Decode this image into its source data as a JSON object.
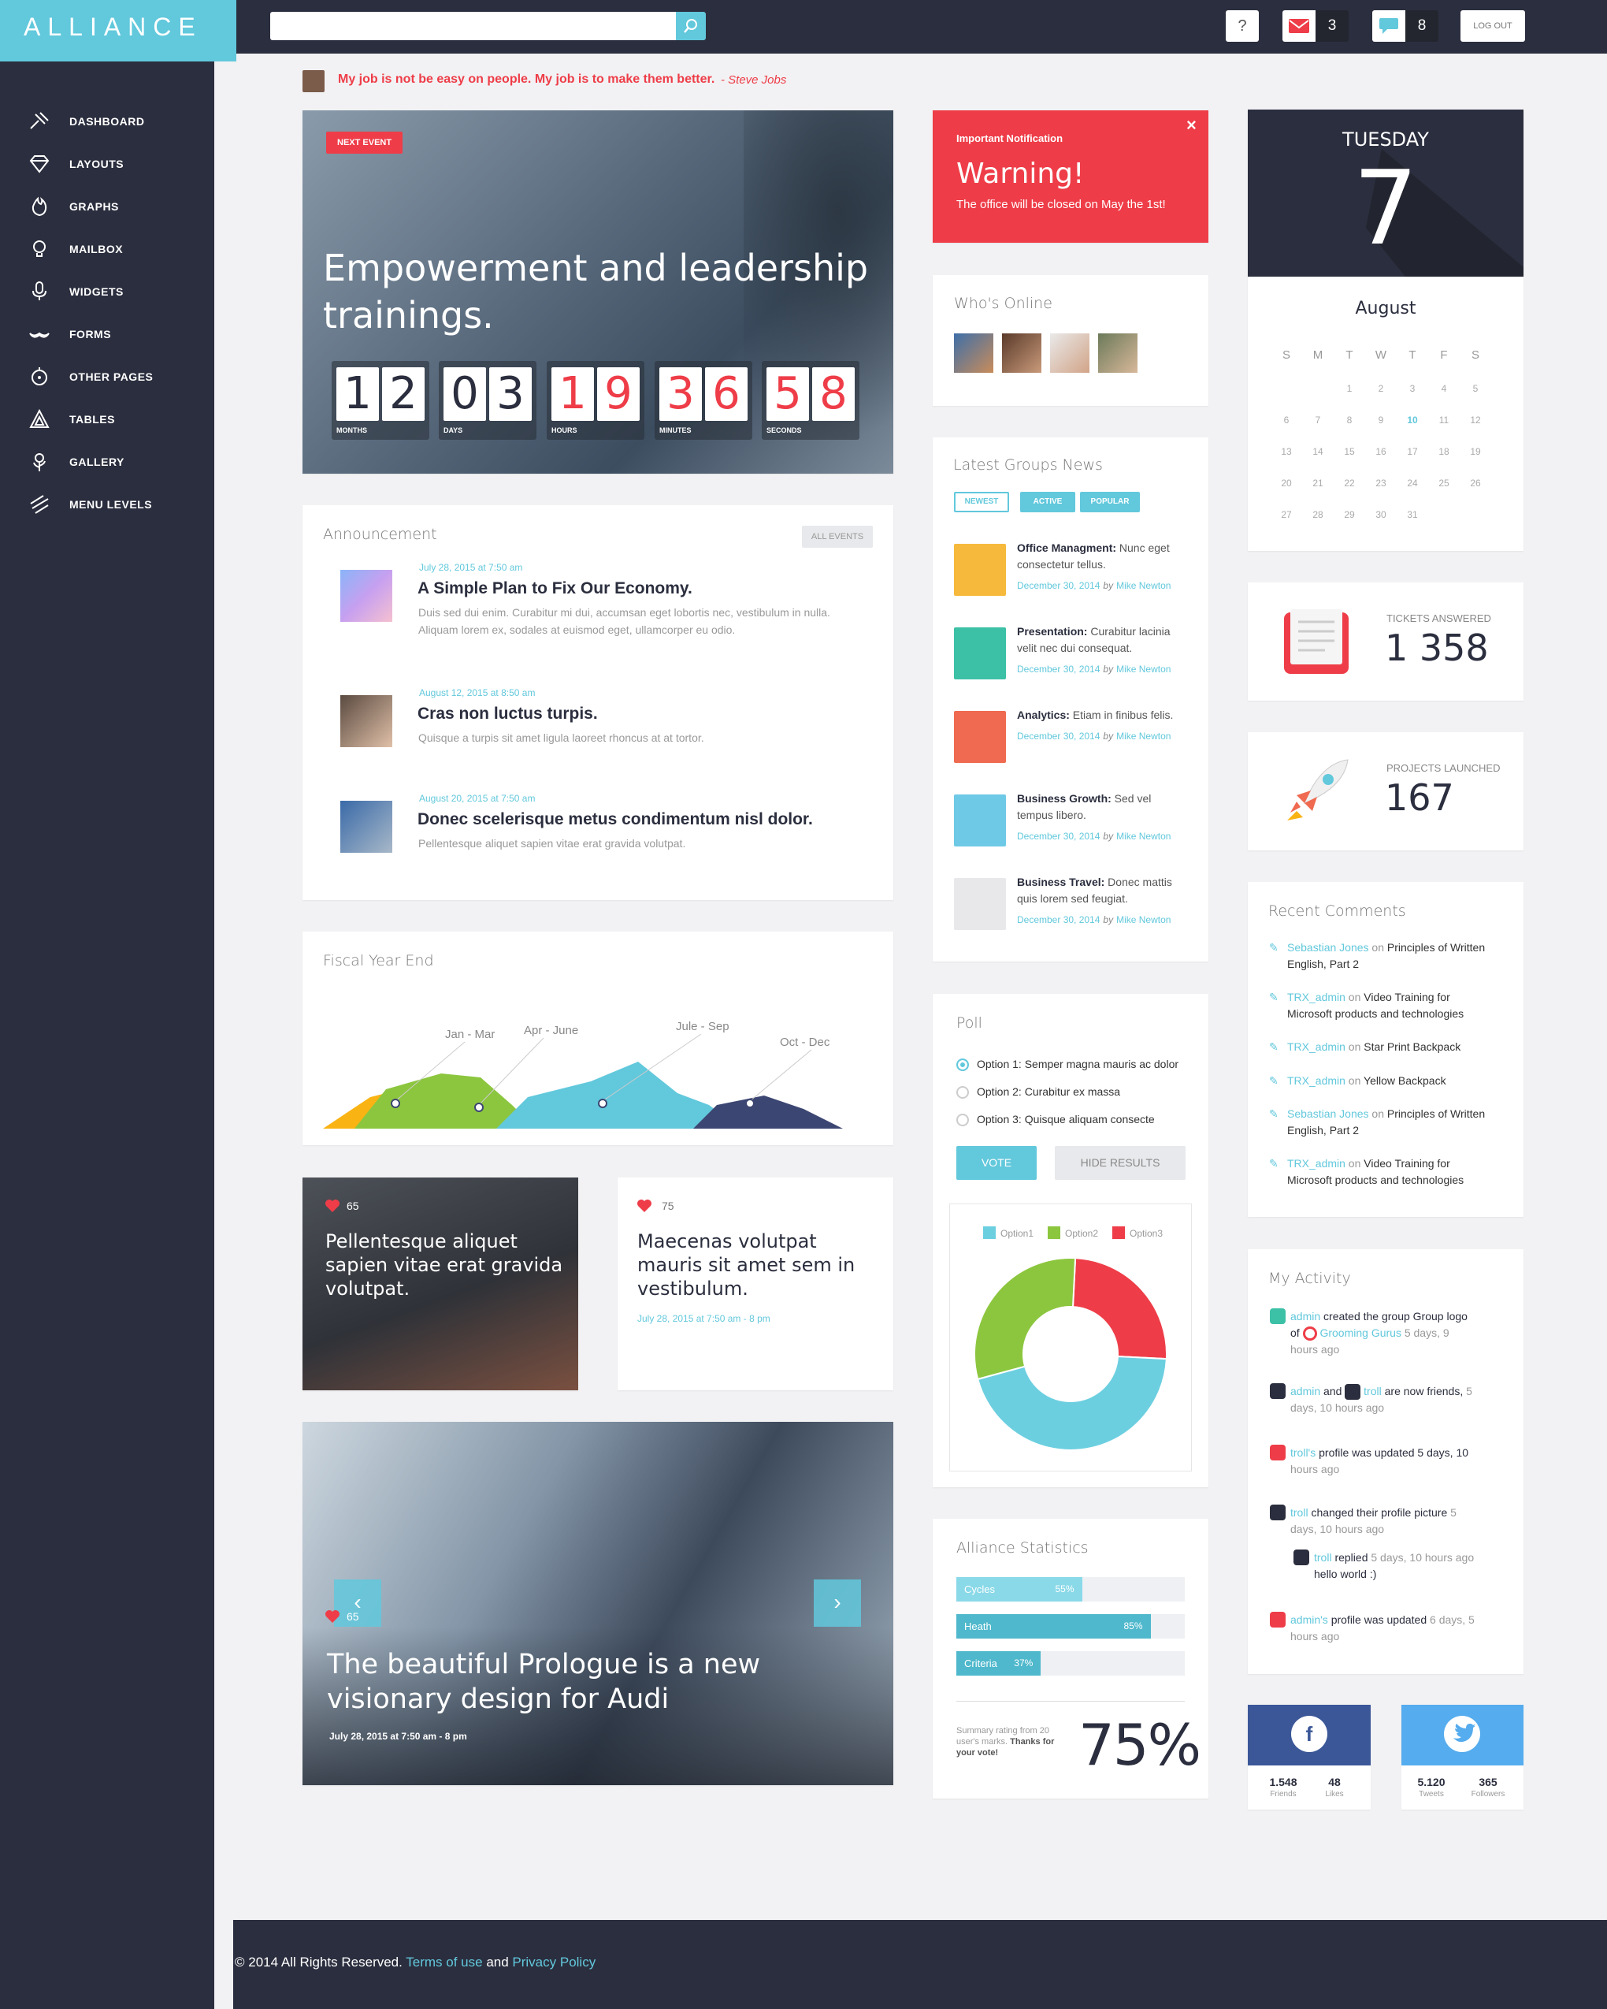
{
  "brand": {
    "logo": "ALLIANCE",
    "accent": "#62c8dc",
    "dark": "#2b2e3e",
    "red": "#ee3d48"
  },
  "topbar": {
    "search_placeholder": "",
    "help": "?",
    "mail_count": "3",
    "chat_count": "8",
    "logout": "LOG OUT"
  },
  "quote": {
    "text": "My job is not be easy on people. My job is to make them better.",
    "author": "- Steve Jobs"
  },
  "nav": [
    {
      "label": "DASHBOARD",
      "icon": "dashboard-icon"
    },
    {
      "label": "LAYOUTS",
      "icon": "diamond-icon"
    },
    {
      "label": "GRAPHS",
      "icon": "fire-icon"
    },
    {
      "label": "MAILBOX",
      "icon": "bulb-icon"
    },
    {
      "label": "WIDGETS",
      "icon": "mic-icon"
    },
    {
      "label": "FORMS",
      "icon": "mustache-icon"
    },
    {
      "label": "OTHER PAGES",
      "icon": "compass-icon"
    },
    {
      "label": "TABLES",
      "icon": "triangle-icon"
    },
    {
      "label": "GALLERY",
      "icon": "flower-icon"
    },
    {
      "label": "MENU LEVELS",
      "icon": "layers-icon"
    }
  ],
  "event": {
    "badge": "NEXT EVENT",
    "title_line1": "Empowerment and leadership",
    "title_line2": "trainings.",
    "countdown": [
      {
        "digits": "12",
        "label": "MONTHS",
        "red": false
      },
      {
        "digits": "03",
        "label": "DAYS",
        "red": false
      },
      {
        "digits": "19",
        "label": "HOURS",
        "red": true
      },
      {
        "digits": "36",
        "label": "MINUTES",
        "red": true
      },
      {
        "digits": "58",
        "label": "SECONDS",
        "red": true
      }
    ]
  },
  "announcement": {
    "title": "Announcement",
    "button": "ALL EVENTS",
    "items": [
      {
        "date": "July  28, 2015 at 7:50 am",
        "title": "A Simple Plan to Fix Our Economy.",
        "text1": "Duis sed dui enim. Curabitur mi dui, accumsan eget lobortis nec, vestibulum in nulla.",
        "text2": "Aliquam lorem ex, sodales at euismod eget, ullamcorper eu odio."
      },
      {
        "date": "August  12, 2015 at 8:50 am",
        "title": "Cras non luctus turpis.",
        "text1": "Quisque a turpis sit amet ligula laoreet rhoncus at at tortor.",
        "text2": ""
      },
      {
        "date": "August  20, 2015 at 7:50 am",
        "title": "Donec scelerisque metus condimentum nisl dolor.",
        "text1": "Pellentesque aliquet sapien vitae erat gravida volutpat.",
        "text2": ""
      }
    ]
  },
  "fiscal": {
    "title": "Fiscal Year End",
    "labels": [
      "Jan - Mar",
      "Apr - June",
      "Jule - Sep",
      "Oct - Dec"
    ]
  },
  "like_cards": [
    {
      "count": "65",
      "text_l1": "Pellentesque aliquet",
      "text_l2": "sapien vitae erat gravida",
      "text_l3": "volutpat."
    },
    {
      "count": "75",
      "text_l1": "Maecenas volutpat",
      "text_l2": "mauris sit amet sem in",
      "text_l3": "vestibulum.",
      "date": "July  28, 2015 at 7:50 am - 8 pm"
    }
  ],
  "slider": {
    "count": "65",
    "title_l1": "The beautiful Prologue is a new",
    "title_l2": "visionary design for Audi",
    "date": "July  28, 2015 at 7:50 am - 8 pm"
  },
  "warning": {
    "label": "Important Notification",
    "title": "Warning!",
    "text": "The office will be closed on May the 1st!",
    "close": "×"
  },
  "online": {
    "title": "Who's Online"
  },
  "groups": {
    "title": "Latest Groups News",
    "tabs": [
      "NEWEST",
      "ACTIVE",
      "POPULAR"
    ],
    "items": [
      {
        "title": "Office Managment:",
        "l1": " Nunc eget",
        "l2": "consectetur tellus.",
        "date": "December 30, 2014",
        "by": "by",
        "author": "Mike Newton",
        "color": "#f6b93b"
      },
      {
        "title": "Presentation:",
        "l1": " Curabitur lacinia",
        "l2": "velit nec dui consequat.",
        "date": "December 30, 2014",
        "by": "by",
        "author": "Mike Newton",
        "color": "#3cc0a6"
      },
      {
        "title": "Analytics:",
        "l1": " Etiam in finibus felis.",
        "l2": "",
        "date": "December 30, 2014",
        "by": "by",
        "author": "Mike Newton",
        "color": "#ef6a50"
      },
      {
        "title": "Business Growth:",
        "l1": " Sed vel",
        "l2": "tempus libero.",
        "date": "December 30, 2014",
        "by": "by",
        "author": "Mike Newton",
        "color": "#6ec9e6"
      },
      {
        "title": "Business Travel:",
        "l1": " Donec mattis",
        "l2": "quis lorem sed feugiat.",
        "date": "December 30, 2014",
        "by": "by",
        "author": "Mike Newton",
        "color": "#e8e8ea"
      }
    ]
  },
  "poll": {
    "title": "Poll",
    "options": [
      "Option 1: Semper magna mauris ac dolor",
      "Option 2: Curabitur ex massa",
      "Option 3: Quisque aliquam consecte"
    ],
    "vote": "VOTE",
    "hide": "HIDE RESULTS",
    "legend": [
      "Option1",
      "Option2",
      "Option3"
    ]
  },
  "chart_data": {
    "type": "pie",
    "title": "",
    "categories": [
      "Option1",
      "Option2",
      "Option3"
    ],
    "values": [
      45,
      30,
      25
    ],
    "colors": [
      "#6ccfe0",
      "#8cc63f",
      "#ee3d48"
    ],
    "legend": "top"
  },
  "stats": {
    "title": "Alliance Statistics",
    "bars": [
      {
        "label": "Cycles",
        "value": 55,
        "pct": "55%"
      },
      {
        "label": "Heath",
        "value": 85,
        "pct": "85%"
      },
      {
        "label": "Criteria",
        "value": 37,
        "pct": "37%"
      }
    ],
    "summary_l1": "Summary rating from 20",
    "summary_l2": "user's marks.",
    "summary_bold": "Thanks for",
    "summary_l3": "your vote!",
    "big": "75%"
  },
  "calendar": {
    "weekday": "TUESDAY",
    "day": "7",
    "month": "August",
    "dows": [
      "S",
      "M",
      "T",
      "W",
      "T",
      "F",
      "S"
    ],
    "today": "10",
    "weeks": [
      [
        "",
        "",
        "1",
        "2",
        "3",
        "4",
        "5"
      ],
      [
        "6",
        "7",
        "8",
        "9",
        "10",
        "11",
        "12"
      ],
      [
        "13",
        "14",
        "15",
        "16",
        "17",
        "18",
        "19"
      ],
      [
        "20",
        "21",
        "22",
        "23",
        "24",
        "25",
        "26"
      ],
      [
        "27",
        "28",
        "29",
        "30",
        "31",
        "",
        ""
      ]
    ]
  },
  "tickets": {
    "label": "TICKETS ANSWERED",
    "value": "1 358"
  },
  "projects": {
    "label": "PROJECTS LAUNCHED",
    "value": "167"
  },
  "comments": {
    "title": "Recent Comments",
    "items": [
      {
        "user": "Sebastian Jones",
        "on": " on ",
        "l1": "Principles of Written",
        "l2": "English, Part 2"
      },
      {
        "user": "TRX_admin",
        "on": " on ",
        "l1": "Video Training for",
        "l2": "Microsoft products and technologies"
      },
      {
        "user": "TRX_admin",
        "on": " on ",
        "l1": "Star Print Backpack",
        "l2": ""
      },
      {
        "user": "TRX_admin",
        "on": " on ",
        "l1": "Yellow Backpack",
        "l2": ""
      },
      {
        "user": "Sebastian Jones",
        "on": " on ",
        "l1": "Principles of Written",
        "l2": "English, Part 2"
      },
      {
        "user": "TRX_admin",
        "on": " on ",
        "l1": "Video Training for",
        "l2": "Microsoft products and technologies"
      }
    ]
  },
  "activity": {
    "title": "My Activity",
    "a1": {
      "user": "admin",
      "t1": " created the group Group logo",
      "of": "of",
      "group": "Grooming Gurus",
      "t2": " 5 days, 9",
      "t3": "hours ago"
    },
    "a2": {
      "u1": "admin",
      "and": " and ",
      "u2": "troll",
      "t1": " are now friends,",
      "t2": " 5",
      "t3": "days, 10 hours ago"
    },
    "a3": {
      "user": "troll's",
      "t1": " profile was updated 5 days, 10",
      "t2": "hours ago"
    },
    "a4": {
      "user": "troll",
      "t1": " changed their profile picture",
      "t2": " 5",
      "t3": "days, 10 hours ago"
    },
    "a5": {
      "user": "troll",
      "t1": " replied",
      "t2": " 5 days, 10 hours ago",
      "t3": "hello world :)"
    },
    "a6": {
      "user": "admin's",
      "t1": " profile was updated",
      "t2": " 6 days, 5",
      "t3": "hours ago"
    }
  },
  "social": {
    "fb": {
      "v1": "1.548",
      "l1": "Friends",
      "v2": "48",
      "l2": "Likes"
    },
    "tw": {
      "v1": "5.120",
      "l1": "Tweets",
      "v2": "365",
      "l2": "Followers"
    }
  },
  "footer": {
    "copy": "© 2014 All Rights Reserved.",
    "terms": "Terms of use",
    "and": " and ",
    "privacy": "Privacy Policy"
  }
}
